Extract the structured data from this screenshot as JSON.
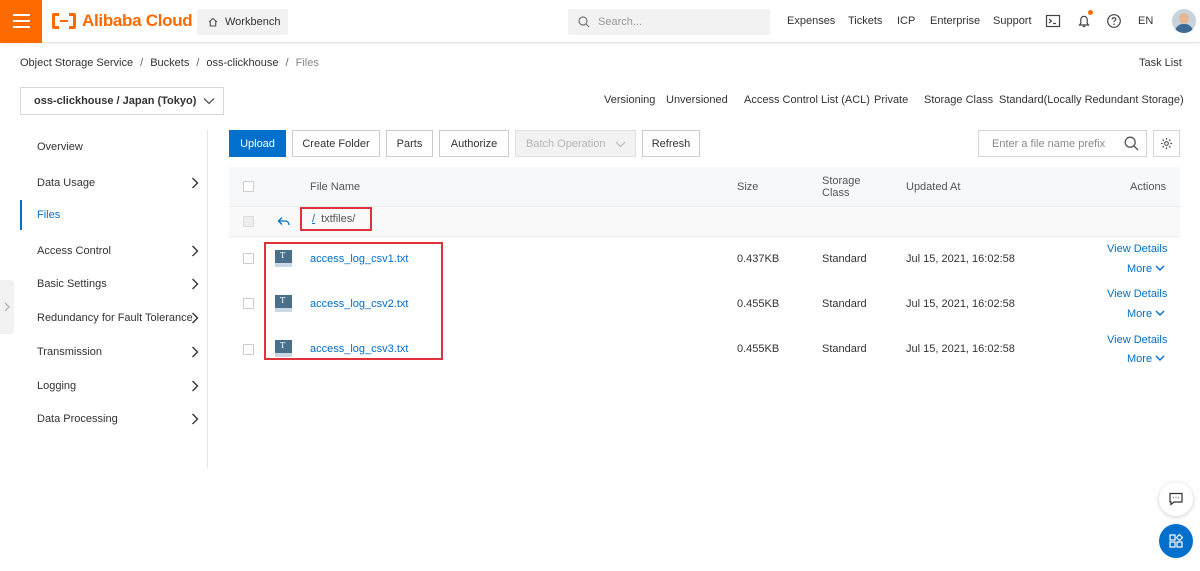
{
  "header": {
    "brand": "Alibaba Cloud",
    "workbench": "Workbench",
    "search_placeholder": "Search...",
    "nav": [
      "Expenses",
      "Tickets",
      "ICP",
      "Enterprise",
      "Support"
    ],
    "language": "EN"
  },
  "breadcrumb": [
    "Object Storage Service",
    "Buckets",
    "oss-clickhouse",
    "Files"
  ],
  "task_list": "Task List",
  "bucket_selector": "oss-clickhouse / Japan (Tokyo)",
  "bucket_meta": {
    "versioning_label": "Versioning",
    "versioning_value": "Unversioned",
    "acl_label": "Access Control List (ACL)",
    "acl_value": "Private",
    "storage_label": "Storage Class",
    "storage_value": "Standard(Locally Redundant Storage)"
  },
  "sidebar": {
    "items": [
      {
        "label": "Overview",
        "has_submenu": false
      },
      {
        "label": "Data Usage",
        "has_submenu": true
      },
      {
        "label": "Files",
        "has_submenu": false,
        "active": true
      },
      {
        "label": "Access Control",
        "has_submenu": true
      },
      {
        "label": "Basic Settings",
        "has_submenu": true
      },
      {
        "label": "Redundancy for Fault Tolerance",
        "has_submenu": true
      },
      {
        "label": "Transmission",
        "has_submenu": true
      },
      {
        "label": "Logging",
        "has_submenu": true
      },
      {
        "label": "Data Processing",
        "has_submenu": true
      }
    ]
  },
  "toolbar": {
    "upload": "Upload",
    "create_folder": "Create Folder",
    "parts": "Parts",
    "authorize": "Authorize",
    "batch_operation": "Batch Operation",
    "refresh": "Refresh",
    "prefix_placeholder": "Enter a file name prefix"
  },
  "table": {
    "headers": {
      "file_name": "File Name",
      "size": "Size",
      "storage_class_1": "Storage",
      "storage_class_2": "Class",
      "updated_at": "Updated At",
      "actions": "Actions"
    },
    "path": {
      "root": "/",
      "folder": "txtfiles/"
    },
    "rows": [
      {
        "name": "access_log_csv1.txt",
        "size": "0.437KB",
        "storage_class": "Standard",
        "updated_at": "Jul 15, 2021, 16:02:58",
        "view": "View Details",
        "more": "More"
      },
      {
        "name": "access_log_csv2.txt",
        "size": "0.455KB",
        "storage_class": "Standard",
        "updated_at": "Jul 15, 2021, 16:02:58",
        "view": "View Details",
        "more": "More"
      },
      {
        "name": "access_log_csv3.txt",
        "size": "0.455KB",
        "storage_class": "Standard",
        "updated_at": "Jul 15, 2021, 16:02:58",
        "view": "View Details",
        "more": "More"
      }
    ]
  },
  "colors": {
    "brand": "#ff6a00",
    "primary": "#0070cc",
    "highlight": "#e0323c"
  }
}
